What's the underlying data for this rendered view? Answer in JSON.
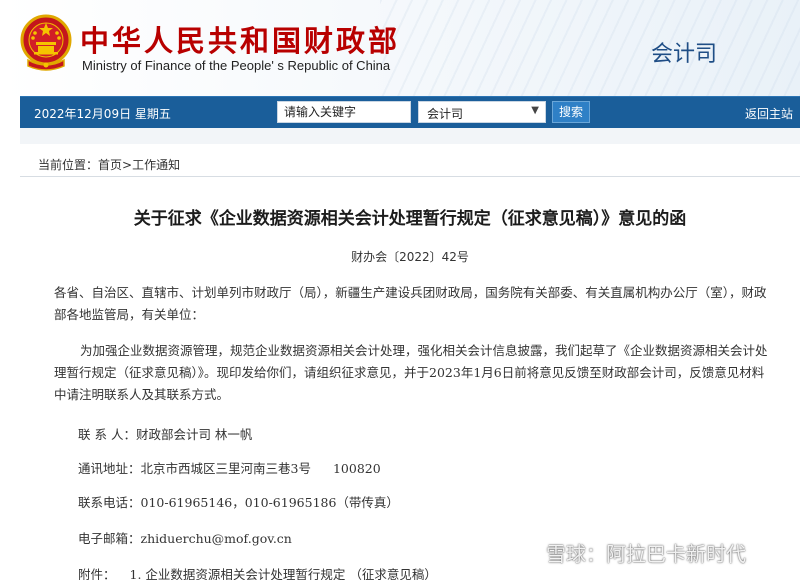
{
  "header": {
    "ministry_cn": "中华人民共和国财政部",
    "ministry_en": "Ministry of Finance of the People' s Republic of China",
    "department": "会计司"
  },
  "navbar": {
    "date": "2022年12月09日  星期五",
    "search_placeholder": "请输入关键字",
    "select_value": "会计司",
    "search_label": "搜索",
    "home_label": "返回主站"
  },
  "breadcrumb": {
    "prefix": "当前位置：",
    "home": "首页",
    "separator": ">",
    "current": "工作通知"
  },
  "document": {
    "title": "关于征求《企业数据资源相关会计处理暂行规定（征求意见稿）》意见的函",
    "number": "财办会〔2022〕42号",
    "addressees": "各省、自治区、直辖市、计划单列市财政厅（局），新疆生产建设兵团财政局，国务院有关部委、有关直属机构办公厅（室），财政部各地监管局，有关单位：",
    "body": "为加强企业数据资源管理，规范企业数据资源相关会计处理，强化相关会计信息披露，我们起草了《企业数据资源相关会计处理暂行规定（征求意见稿）》。现印发给你们，请组织征求意见，并于2023年1月6日前将意见反馈至财政部会计司，反馈意见材料中请注明联系人及其联系方式。",
    "contact_label": "联  系  人：",
    "contact_value": "财政部会计司     林一帆",
    "address_label": "通讯地址：",
    "address_value": "北京市西城区三里河南三巷3号",
    "postcode": "100820",
    "phone_label": "联系电话：",
    "phone_value": "010-61965146，010-61965186（带传真）",
    "email_label": "电子邮箱：",
    "email_value": "zhiduerchu@mof.gov.cn",
    "attachment_label": "附件：",
    "attachment_value": "1. 企业数据资源相关会计处理暂行规定  （征求意见稿）"
  },
  "watermark": {
    "text": "雪球：阿拉巴卡新时代"
  },
  "colors": {
    "brand_red": "#b80000",
    "nav_blue": "#1a5e9a",
    "button_blue": "#2f80c6",
    "dept_blue": "#1f4e86"
  },
  "icons": {
    "emblem": "national-emblem-icon",
    "dropdown": "chevron-down-icon",
    "watermark_logo": "snowball-logo-icon"
  }
}
